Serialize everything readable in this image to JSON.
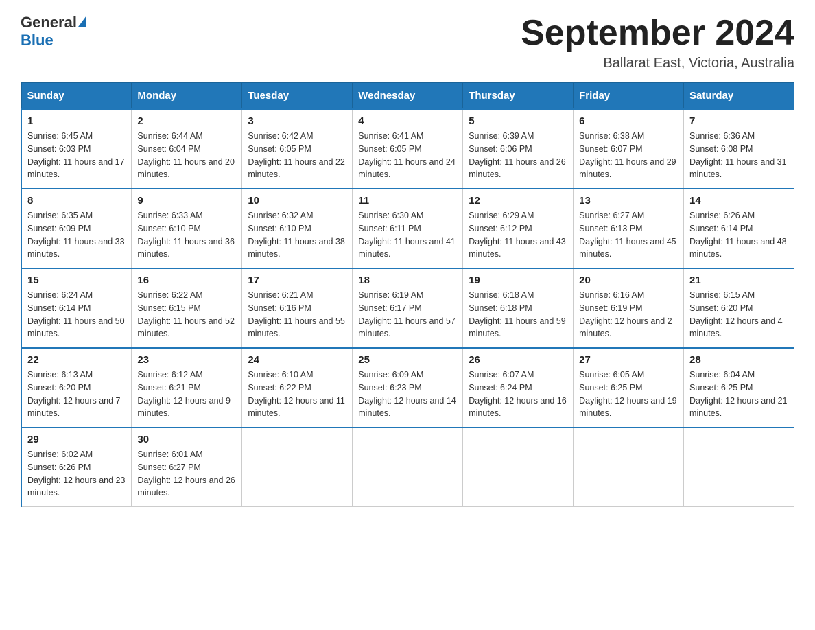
{
  "header": {
    "logo_general": "General",
    "logo_blue": "Blue",
    "month_title": "September 2024",
    "location": "Ballarat East, Victoria, Australia"
  },
  "days_of_week": [
    "Sunday",
    "Monday",
    "Tuesday",
    "Wednesday",
    "Thursday",
    "Friday",
    "Saturday"
  ],
  "weeks": [
    [
      {
        "day": "1",
        "sunrise": "6:45 AM",
        "sunset": "6:03 PM",
        "daylight": "11 hours and 17 minutes."
      },
      {
        "day": "2",
        "sunrise": "6:44 AM",
        "sunset": "6:04 PM",
        "daylight": "11 hours and 20 minutes."
      },
      {
        "day": "3",
        "sunrise": "6:42 AM",
        "sunset": "6:05 PM",
        "daylight": "11 hours and 22 minutes."
      },
      {
        "day": "4",
        "sunrise": "6:41 AM",
        "sunset": "6:05 PM",
        "daylight": "11 hours and 24 minutes."
      },
      {
        "day": "5",
        "sunrise": "6:39 AM",
        "sunset": "6:06 PM",
        "daylight": "11 hours and 26 minutes."
      },
      {
        "day": "6",
        "sunrise": "6:38 AM",
        "sunset": "6:07 PM",
        "daylight": "11 hours and 29 minutes."
      },
      {
        "day": "7",
        "sunrise": "6:36 AM",
        "sunset": "6:08 PM",
        "daylight": "11 hours and 31 minutes."
      }
    ],
    [
      {
        "day": "8",
        "sunrise": "6:35 AM",
        "sunset": "6:09 PM",
        "daylight": "11 hours and 33 minutes."
      },
      {
        "day": "9",
        "sunrise": "6:33 AM",
        "sunset": "6:10 PM",
        "daylight": "11 hours and 36 minutes."
      },
      {
        "day": "10",
        "sunrise": "6:32 AM",
        "sunset": "6:10 PM",
        "daylight": "11 hours and 38 minutes."
      },
      {
        "day": "11",
        "sunrise": "6:30 AM",
        "sunset": "6:11 PM",
        "daylight": "11 hours and 41 minutes."
      },
      {
        "day": "12",
        "sunrise": "6:29 AM",
        "sunset": "6:12 PM",
        "daylight": "11 hours and 43 minutes."
      },
      {
        "day": "13",
        "sunrise": "6:27 AM",
        "sunset": "6:13 PM",
        "daylight": "11 hours and 45 minutes."
      },
      {
        "day": "14",
        "sunrise": "6:26 AM",
        "sunset": "6:14 PM",
        "daylight": "11 hours and 48 minutes."
      }
    ],
    [
      {
        "day": "15",
        "sunrise": "6:24 AM",
        "sunset": "6:14 PM",
        "daylight": "11 hours and 50 minutes."
      },
      {
        "day": "16",
        "sunrise": "6:22 AM",
        "sunset": "6:15 PM",
        "daylight": "11 hours and 52 minutes."
      },
      {
        "day": "17",
        "sunrise": "6:21 AM",
        "sunset": "6:16 PM",
        "daylight": "11 hours and 55 minutes."
      },
      {
        "day": "18",
        "sunrise": "6:19 AM",
        "sunset": "6:17 PM",
        "daylight": "11 hours and 57 minutes."
      },
      {
        "day": "19",
        "sunrise": "6:18 AM",
        "sunset": "6:18 PM",
        "daylight": "11 hours and 59 minutes."
      },
      {
        "day": "20",
        "sunrise": "6:16 AM",
        "sunset": "6:19 PM",
        "daylight": "12 hours and 2 minutes."
      },
      {
        "day": "21",
        "sunrise": "6:15 AM",
        "sunset": "6:20 PM",
        "daylight": "12 hours and 4 minutes."
      }
    ],
    [
      {
        "day": "22",
        "sunrise": "6:13 AM",
        "sunset": "6:20 PM",
        "daylight": "12 hours and 7 minutes."
      },
      {
        "day": "23",
        "sunrise": "6:12 AM",
        "sunset": "6:21 PM",
        "daylight": "12 hours and 9 minutes."
      },
      {
        "day": "24",
        "sunrise": "6:10 AM",
        "sunset": "6:22 PM",
        "daylight": "12 hours and 11 minutes."
      },
      {
        "day": "25",
        "sunrise": "6:09 AM",
        "sunset": "6:23 PM",
        "daylight": "12 hours and 14 minutes."
      },
      {
        "day": "26",
        "sunrise": "6:07 AM",
        "sunset": "6:24 PM",
        "daylight": "12 hours and 16 minutes."
      },
      {
        "day": "27",
        "sunrise": "6:05 AM",
        "sunset": "6:25 PM",
        "daylight": "12 hours and 19 minutes."
      },
      {
        "day": "28",
        "sunrise": "6:04 AM",
        "sunset": "6:25 PM",
        "daylight": "12 hours and 21 minutes."
      }
    ],
    [
      {
        "day": "29",
        "sunrise": "6:02 AM",
        "sunset": "6:26 PM",
        "daylight": "12 hours and 23 minutes."
      },
      {
        "day": "30",
        "sunrise": "6:01 AM",
        "sunset": "6:27 PM",
        "daylight": "12 hours and 26 minutes."
      },
      null,
      null,
      null,
      null,
      null
    ]
  ],
  "labels": {
    "sunrise": "Sunrise:",
    "sunset": "Sunset:",
    "daylight": "Daylight:"
  }
}
